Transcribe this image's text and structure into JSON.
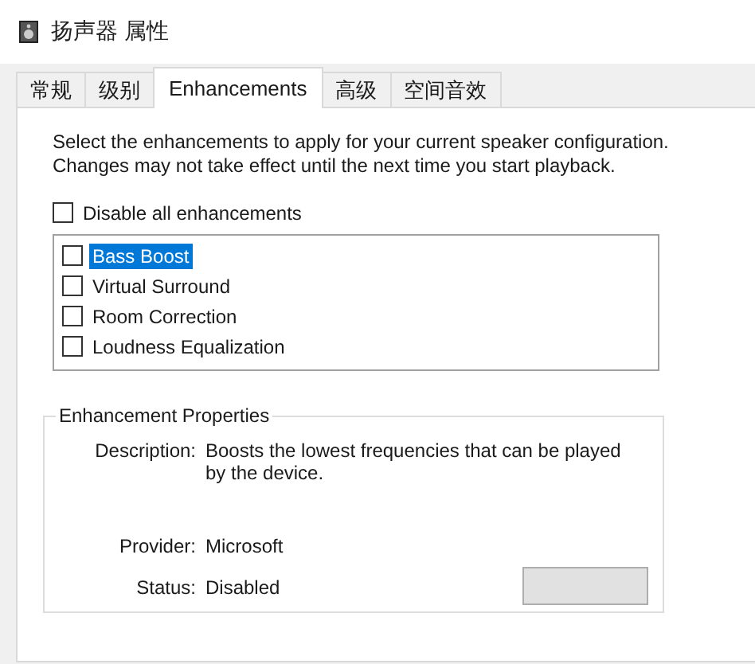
{
  "window": {
    "title": "扬声器 属性"
  },
  "tabs": [
    {
      "label": "常规",
      "selected": false
    },
    {
      "label": "级别",
      "selected": false
    },
    {
      "label": "Enhancements",
      "selected": true
    },
    {
      "label": "高级",
      "selected": false
    },
    {
      "label": "空间音效",
      "selected": false
    }
  ],
  "intro": "Select the enhancements to apply for your current speaker configuration. Changes may not take effect until the next time you start playback.",
  "disable_all": {
    "label": "Disable all enhancements",
    "checked": false
  },
  "enhancements": [
    {
      "label": "Bass Boost",
      "checked": false,
      "selected": true
    },
    {
      "label": "Virtual Surround",
      "checked": false,
      "selected": false
    },
    {
      "label": "Room Correction",
      "checked": false,
      "selected": false
    },
    {
      "label": "Loudness Equalization",
      "checked": false,
      "selected": false
    }
  ],
  "properties": {
    "title": "Enhancement Properties",
    "fields": [
      {
        "label": "Description:",
        "value": "Boosts the lowest frequencies that can be played by the device."
      },
      {
        "label": "Provider:",
        "value": "Microsoft"
      },
      {
        "label": "Status:",
        "value": "Disabled"
      }
    ]
  }
}
